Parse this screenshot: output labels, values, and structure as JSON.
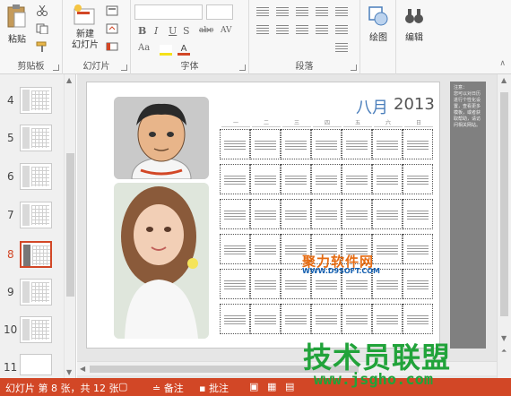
{
  "ribbon": {
    "groups": {
      "clipboard": "剪贴板",
      "slides": "幻灯片",
      "font": "字体",
      "paragraph": "段落",
      "drawing": "绘图",
      "editing": "编辑"
    },
    "paste_label": "粘贴",
    "new_slide_label": "新建\n幻灯片",
    "font_buttons": [
      "B",
      "I",
      "U",
      "S",
      "abc",
      "AV",
      "Aa"
    ],
    "drawing_label": "绘图",
    "editing_label": "编辑"
  },
  "thumbnails": {
    "numbers": [
      "4",
      "5",
      "6",
      "7",
      "8",
      "9",
      "10",
      "11"
    ],
    "selected": "8"
  },
  "slide": {
    "month": "八月",
    "year": "2013",
    "weekdays": [
      "一",
      "二",
      "三",
      "四",
      "五",
      "六",
      "日"
    ],
    "notes_title": "注意：",
    "notes_body": "您可以对日历进行个性化设置，查看更多模板，或者获取帮助，请访问相关网站。"
  },
  "watermarks": {
    "site_cn": "聚力软件网",
    "site_en": "WWW.D9SOFT.COM",
    "brand": "技术员联盟",
    "brand_url": "www.jsgho.com"
  },
  "status": {
    "slide_counter": "幻灯片 第 8 张，共 12 张",
    "notes": "备注",
    "comments": "批注"
  },
  "colors": {
    "accent": "#d24726",
    "month": "#4a7ebb"
  }
}
